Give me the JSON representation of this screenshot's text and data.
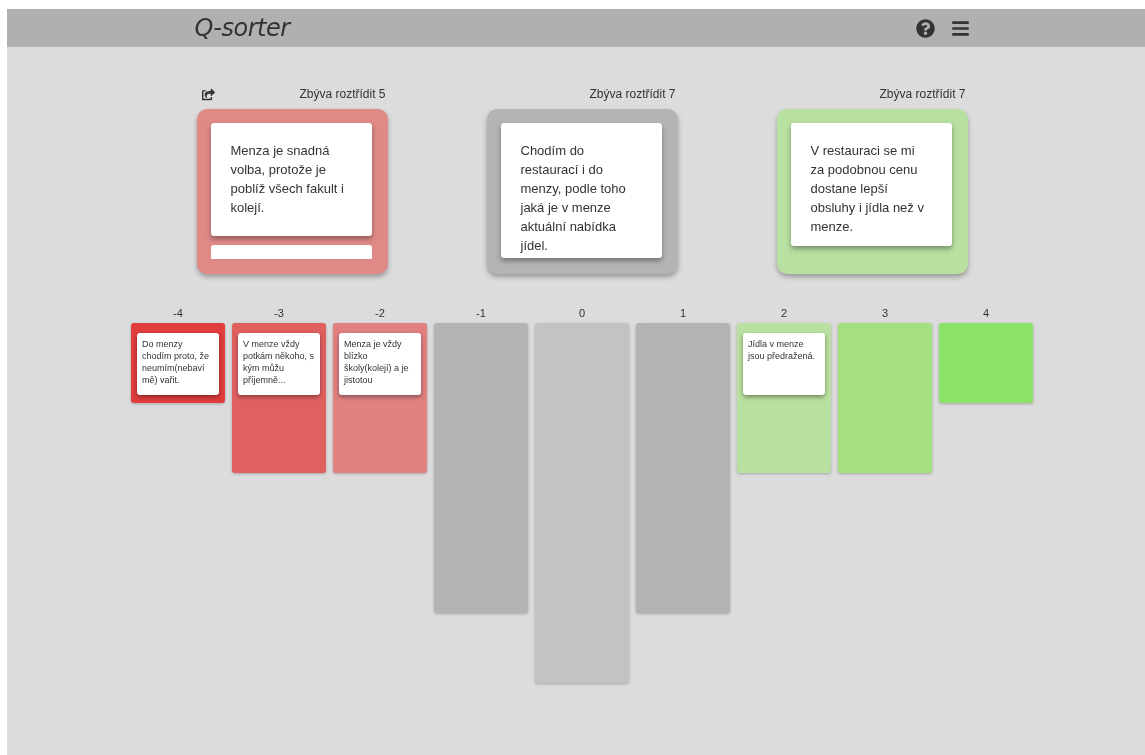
{
  "header": {
    "title": "Q-sorter"
  },
  "piles": [
    {
      "remaining": "Zbýva roztřídit 5",
      "color": "#e08a88",
      "reset": true,
      "stacked": true,
      "card": "Menza je snadná volba, protože je poblíž všech fakult i kolejí."
    },
    {
      "remaining": "Zbýva roztřídit 7",
      "color": "#b5b4b2",
      "reset": false,
      "stacked": false,
      "card": "Chodím do restaurací i do menzy, podle toho jaká je v menze aktuální nabídka jídel."
    },
    {
      "remaining": "Zbýva roztřídit 7",
      "color": "#b8e0a0",
      "reset": false,
      "stacked": false,
      "card": "V restauraci se mi za podobnou cenu dostane lepší obsluhy i jídla než v menze."
    }
  ],
  "columns": [
    {
      "label": "-4",
      "color": "#e03d3d",
      "card": "Do menzy chodím proto, že neumím(nebaví mě) vařit."
    },
    {
      "label": "-3",
      "color": "#e06060",
      "card": "V menze vždy potkám někoho, s kým můžu příjemně..."
    },
    {
      "label": "-2",
      "color": "#e08080",
      "card": "Menza je vždy blízko školy(kolejí) a je jistotou"
    },
    {
      "label": "-1",
      "color": "#b5b4b2"
    },
    {
      "label": "0",
      "color": "#c4c3c1"
    },
    {
      "label": "1",
      "color": "#b5b4b2"
    },
    {
      "label": "2",
      "color": "#b8e0a0",
      "card": "Jídla v menze jsou předražená."
    },
    {
      "label": "3",
      "color": "#a4e082"
    },
    {
      "label": "4",
      "color": "#8ce266"
    }
  ]
}
